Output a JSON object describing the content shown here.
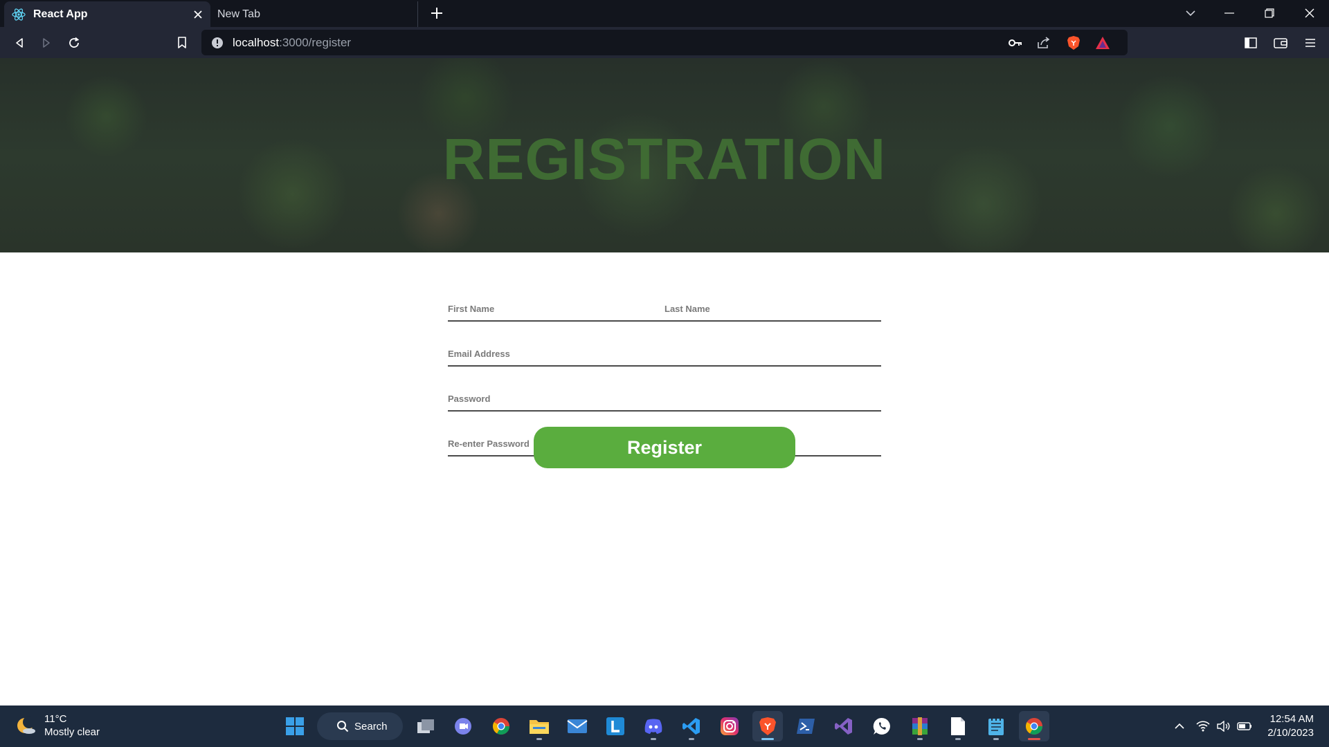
{
  "browser": {
    "tabs": [
      {
        "title": "React App",
        "active": true,
        "favicon": "react-icon"
      },
      {
        "title": "New Tab",
        "active": false
      }
    ],
    "url_host": "localhost",
    "url_path": ":3000/register"
  },
  "page": {
    "hero_title": "REGISTRATION",
    "form": {
      "first_name_placeholder": "First Name",
      "last_name_placeholder": "Last Name",
      "email_placeholder": "Email Address",
      "password_placeholder": "Password",
      "reenter_password_placeholder": "Re-enter Password",
      "register_label": "Register"
    }
  },
  "taskbar": {
    "weather_temp": "11°C",
    "weather_desc": "Mostly clear",
    "search_label": "Search",
    "time": "12:54 AM",
    "date": "2/10/2023",
    "apps": [
      "start",
      "search",
      "task-view",
      "teams",
      "chrome",
      "file-explorer",
      "mail",
      "l-app",
      "discord",
      "vscode",
      "instagram",
      "brave",
      "powershell",
      "visual-studio",
      "whatsapp",
      "winrar",
      "file",
      "notepad",
      "chrome-active"
    ]
  },
  "colors": {
    "accent_green": "#5aad3e",
    "hero_title_green": "#3f6b33",
    "chrome_dark": "#12151d",
    "chrome_toolbar": "#232735",
    "taskbar": "#1d2b3e"
  }
}
